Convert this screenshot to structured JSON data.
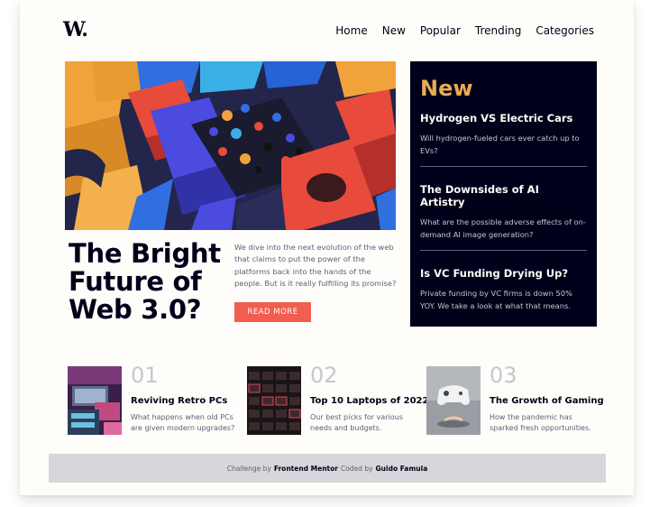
{
  "header": {
    "logo": "W.",
    "nav": [
      "Home",
      "New",
      "Popular",
      "Trending",
      "Categories"
    ]
  },
  "hero": {
    "headline": "The Bright Future of Web 3.0?",
    "lede": "We dive into the next evolution of the web that claims to put the power of the platforms back into the hands of the people. But is it really fulfilling its promise?",
    "cta": "READ MORE"
  },
  "new_panel": {
    "title": "New",
    "items": [
      {
        "title": "Hydrogen VS Electric Cars",
        "desc": "Will hydrogen-fueled cars ever catch up to EVs?"
      },
      {
        "title": "The Downsides of AI Artistry",
        "desc": "What are the possible adverse effects of on-demand AI image generation?"
      },
      {
        "title": "Is VC Funding Drying Up?",
        "desc": "Private funding by VC firms is down 50% YOY. We take a look at what that means."
      }
    ]
  },
  "tiles": [
    {
      "num": "01",
      "title": "Reviving Retro PCs",
      "desc": "What happens when old PCs are given modern upgrades?"
    },
    {
      "num": "02",
      "title": "Top 10 Laptops of 2022",
      "desc": "Our best picks for various needs and budgets."
    },
    {
      "num": "03",
      "title": "The Growth of Gaming",
      "desc": "How the pandemic has sparked fresh opportunities."
    }
  ],
  "footer": {
    "prefix": "Challenge by",
    "challenge_by": "Frontend Mentor",
    "middle": "Coded by",
    "coded_by": "Guido Famula"
  },
  "colors": {
    "accent": "#f15d51",
    "gold": "#e9ab53",
    "dark": "#00001a",
    "text_muted": "#5d5f79",
    "bg": "#fffdfa"
  }
}
